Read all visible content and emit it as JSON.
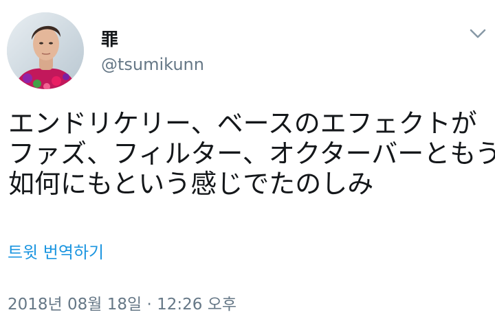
{
  "tweet": {
    "author": {
      "display_name": "罪",
      "handle": "@tsumikunn"
    },
    "menu_icon": "chevron-down-icon",
    "body_lines": [
      "エンドリケリー、ベースのエフェクトが",
      "ファズ、フィルター、オクターバーともう",
      "如何にもという感じでたのしみ"
    ],
    "translate_label": "트윗 번역하기",
    "timestamp": "2018년 08월 18일 · 12:26 오후"
  },
  "colors": {
    "text_primary": "#14171a",
    "text_secondary": "#657786",
    "link": "#1b95e0",
    "background": "#ffffff"
  }
}
